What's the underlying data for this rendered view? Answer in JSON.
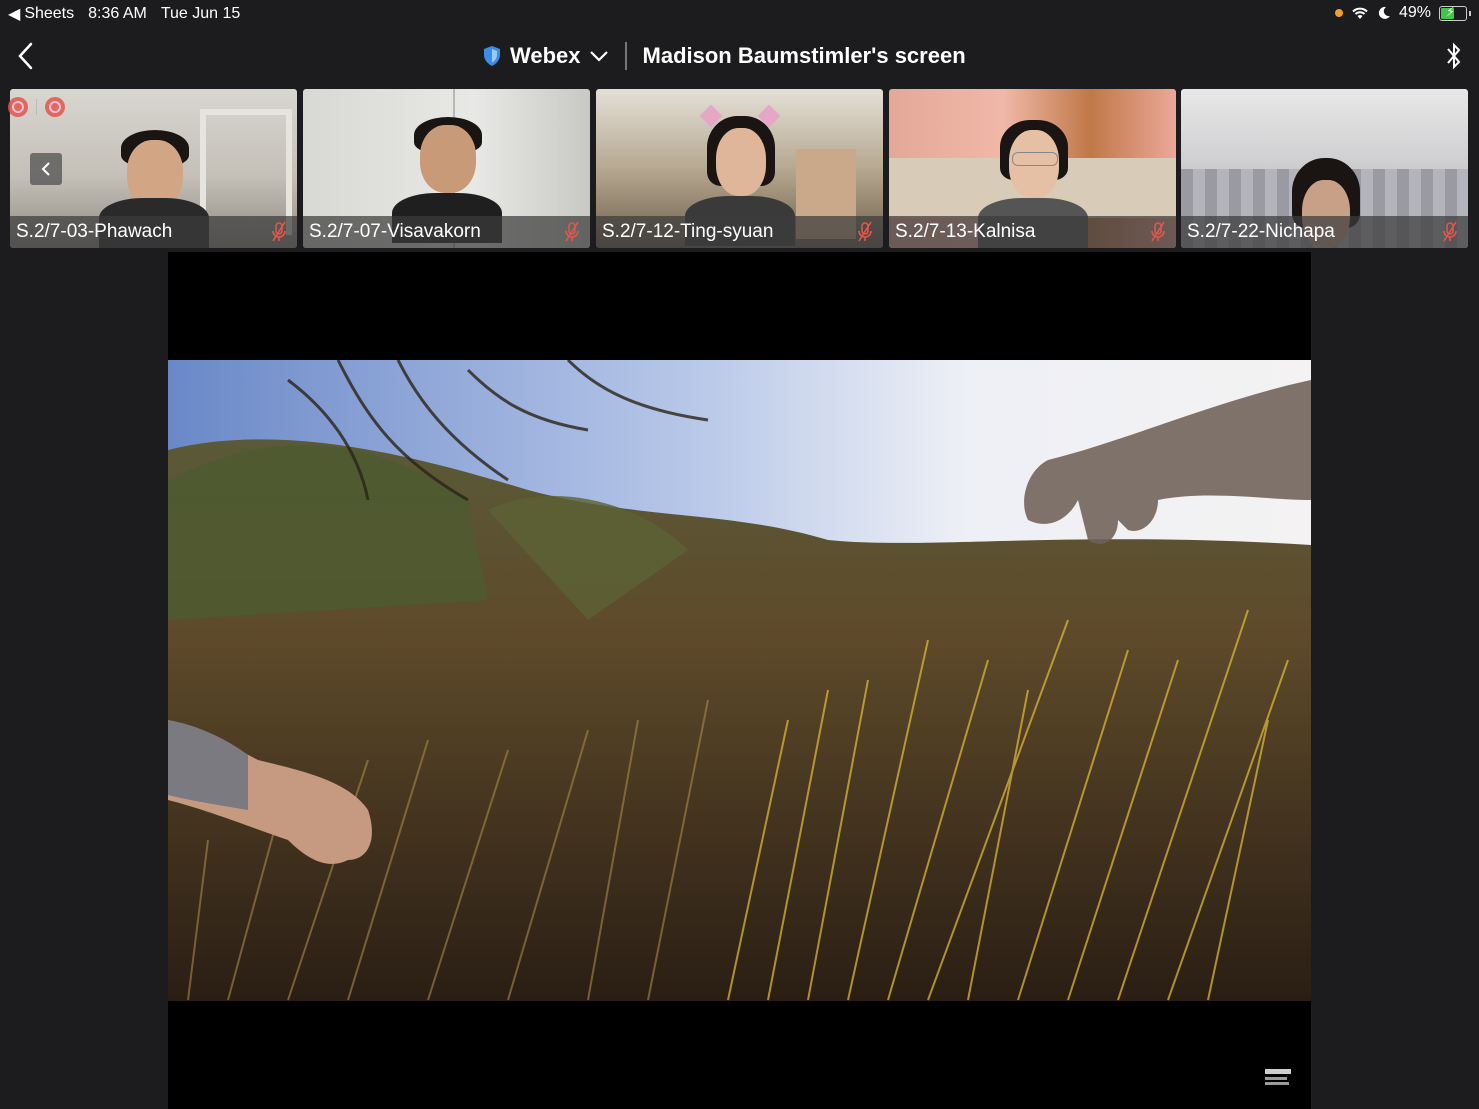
{
  "status_bar": {
    "back_app": "Sheets",
    "time": "8:36 AM",
    "date": "Tue Jun 15",
    "battery": "49%",
    "battery_level": 0.49
  },
  "header": {
    "app_name": "Webex",
    "screen_title": "Madison Baumstimler's screen"
  },
  "participants": [
    {
      "name": "S.2/7-03-Phawach",
      "muted": true
    },
    {
      "name": "S.2/7-07-Visavakorn",
      "muted": true
    },
    {
      "name": "S.2/7-12-Ting-syuan",
      "muted": true
    },
    {
      "name": "S.2/7-13-Kalnisa",
      "muted": true
    },
    {
      "name": "S.2/7-22-Nichapa",
      "muted": true
    }
  ],
  "colors": {
    "background": "#1c1c1e",
    "accent_blue": "#3a8ee6",
    "mute_red": "#e2574c",
    "recording_orange": "#f39c2c",
    "battery_green": "#3ec847"
  },
  "icons": {
    "header_back": "chevron-left-icon",
    "shield": "shield-icon",
    "dropdown": "chevron-down-icon",
    "bluetooth": "bluetooth-icon",
    "mic_muted": "mic-muted-icon"
  }
}
